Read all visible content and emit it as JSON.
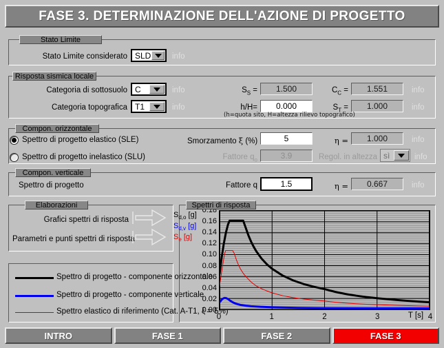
{
  "header": {
    "title": "FASE 3. DETERMINAZIONE DELL'AZIONE DI PROGETTO"
  },
  "colors": {
    "background": "#c0c0c0",
    "panel": "#878787",
    "title_bar": "#828282",
    "active_tab": "#f20000",
    "info_text": "#e0e0e0",
    "curve_horizontal": "#000000",
    "curve_vertical": "#0000ee",
    "curve_elastic": "#e00000"
  },
  "stato_limite": {
    "group_title": "Stato Limite",
    "label": "Stato Limite considerato",
    "value": "SLD",
    "info": "info"
  },
  "risposta_sismica": {
    "group_title": "Risposta sismica locale",
    "sottosuolo_label": "Categoria di sottosuolo",
    "sottosuolo_value": "C",
    "sottosuolo_info": "info",
    "topografica_label": "Categoria topografica",
    "topografica_value": "T1",
    "topografica_info": "info",
    "ss_label": "S",
    "ss_sub": "S",
    "ss_eq": " =",
    "ss_value": "1.500",
    "cc_label": "C",
    "cc_sub": "C",
    "cc_eq": " =",
    "cc_value": "1.551",
    "cc_info": "info",
    "hH_label": "h/H=",
    "hH_value": "0.000",
    "st_label": "S",
    "st_sub": "T",
    "st_eq": " =",
    "st_value": "1.000",
    "st_info": "info",
    "note": "(h=quota sito, H=altezza rilievo topografico)"
  },
  "compon_orizzontale": {
    "group_title": "Compon. orizzontale",
    "radio_sle": "Spettro di progetto elastico (SLE)",
    "radio_slu": "Spettro di progetto inelastico (SLU)",
    "selected": "sle",
    "smorzamento_label": "Smorzamento",
    "smorzamento_symbol": "ξ",
    "smorzamento_unit": "(%)",
    "smorzamento_value": "5",
    "eta_label": "η =",
    "eta_value": "1.000",
    "eta_info": "info",
    "fattore_q0_label": "Fattore q",
    "fattore_q0_sub": "o",
    "fattore_q0_value": "3.9",
    "regol_label": "Regol. in altezza",
    "regol_value": "sì",
    "regol_info": "info"
  },
  "compon_verticale": {
    "group_title": "Compon. verticale",
    "label": "Spettro di progetto",
    "fattore_q_label": "Fattore q",
    "fattore_q_value": "1.5",
    "eta_label": "η =",
    "eta_value": "0.667",
    "eta_info": "info"
  },
  "elaborazioni": {
    "group_title": "Elaborazioni",
    "btn_grafici": "Grafici spettri di risposta",
    "btn_parametri": "Parametri e punti spettri di risposta"
  },
  "legend": {
    "items": [
      {
        "color": "#000000",
        "thickness": 3,
        "text": "Spettro di progetto - componente orizzontale"
      },
      {
        "color": "#0000ee",
        "thickness": 3,
        "text": "Spettro di progetto - componente verticale"
      },
      {
        "color": "#e00000",
        "thickness": 1,
        "text": "Spettro elastico di riferimento (Cat. A-T1, ξ = 5%)"
      }
    ]
  },
  "chart_data": {
    "type": "line",
    "title": "Spettri di risposta",
    "xlabel": "T [s]",
    "ylabel": "",
    "xlim": [
      0,
      4
    ],
    "ylim": [
      0,
      0.18
    ],
    "xticks": [
      0,
      1,
      2,
      3,
      4
    ],
    "xticklabels": [
      "0",
      "1",
      "2",
      "3",
      "4"
    ],
    "yticks": [
      0.0,
      0.02,
      0.04,
      0.06,
      0.08,
      0.1,
      0.12,
      0.14,
      0.16,
      0.18
    ],
    "yticklabels": [
      "0.00",
      "0.02",
      "0.04",
      "0.06",
      "0.08",
      "0.10",
      "0.12",
      "0.14",
      "0.16",
      "0.18"
    ],
    "grid": true,
    "axis_legend": [
      {
        "text": "S",
        "sub": "d,o",
        "unit": "[g]",
        "color": "#000000"
      },
      {
        "text": "S",
        "sub": "d,v",
        "unit": "[g]",
        "color": "#0000ee"
      },
      {
        "text": "S",
        "sub": "e",
        "unit": "[g]",
        "color": "#e00000"
      }
    ],
    "series": [
      {
        "name": "Spettro di progetto - componente orizzontale",
        "color": "#000000",
        "width": 3,
        "points": [
          [
            0.0,
            0.0648
          ],
          [
            0.04,
            0.095
          ],
          [
            0.08,
            0.12
          ],
          [
            0.12,
            0.14
          ],
          [
            0.16,
            0.155
          ],
          [
            0.19,
            0.162
          ],
          [
            0.25,
            0.162
          ],
          [
            0.35,
            0.162
          ],
          [
            0.45,
            0.162
          ],
          [
            0.5,
            0.1485
          ],
          [
            0.55,
            0.135
          ],
          [
            0.6,
            0.1238
          ],
          [
            0.65,
            0.1143
          ],
          [
            0.7,
            0.1061
          ],
          [
            0.8,
            0.0928
          ],
          [
            0.9,
            0.0825
          ],
          [
            1.0,
            0.0743
          ],
          [
            1.2,
            0.0619
          ],
          [
            1.4,
            0.053
          ],
          [
            1.6,
            0.0464
          ],
          [
            1.8,
            0.0413
          ],
          [
            2.0,
            0.0371
          ],
          [
            2.2,
            0.0321
          ],
          [
            2.4,
            0.0282
          ],
          [
            2.6,
            0.0251
          ],
          [
            2.8,
            0.0225
          ],
          [
            3.0,
            0.0204
          ],
          [
            3.2,
            0.0187
          ],
          [
            3.4,
            0.017
          ],
          [
            3.6,
            0.0155
          ],
          [
            3.8,
            0.0142
          ],
          [
            4.0,
            0.013
          ]
        ]
      },
      {
        "name": "Spettro di progetto - componente verticale",
        "color": "#0000ee",
        "width": 3,
        "points": [
          [
            0.0,
            0.013
          ],
          [
            0.03,
            0.0165
          ],
          [
            0.05,
            0.019
          ],
          [
            0.08,
            0.0205
          ],
          [
            0.1,
            0.021
          ],
          [
            0.13,
            0.0205
          ],
          [
            0.16,
            0.019
          ],
          [
            0.2,
            0.016
          ],
          [
            0.25,
            0.013
          ],
          [
            0.3,
            0.0108
          ],
          [
            0.4,
            0.0082
          ],
          [
            0.5,
            0.0068
          ],
          [
            0.6,
            0.0058
          ],
          [
            0.8,
            0.0048
          ],
          [
            1.0,
            0.004
          ],
          [
            1.2,
            0.0034
          ],
          [
            1.5,
            0.0028
          ],
          [
            2.0,
            0.0024
          ],
          [
            2.5,
            0.0022
          ],
          [
            3.0,
            0.0021
          ],
          [
            3.5,
            0.002
          ],
          [
            4.0,
            0.002
          ]
        ]
      },
      {
        "name": "Spettro elastico di riferimento (Cat. A-T1, ξ = 5%)",
        "color": "#e00000",
        "width": 1,
        "points": [
          [
            0.0,
            0.0432
          ],
          [
            0.02,
            0.056
          ],
          [
            0.04,
            0.069
          ],
          [
            0.06,
            0.081
          ],
          [
            0.08,
            0.093
          ],
          [
            0.1,
            0.103
          ],
          [
            0.115,
            0.1075
          ],
          [
            0.15,
            0.1075
          ],
          [
            0.2,
            0.1075
          ],
          [
            0.25,
            0.1075
          ],
          [
            0.28,
            0.102
          ],
          [
            0.32,
            0.0905
          ],
          [
            0.36,
            0.081
          ],
          [
            0.4,
            0.0735
          ],
          [
            0.45,
            0.066
          ],
          [
            0.5,
            0.06
          ],
          [
            0.6,
            0.05
          ],
          [
            0.7,
            0.0428
          ],
          [
            0.8,
            0.0378
          ],
          [
            0.9,
            0.0338
          ],
          [
            1.0,
            0.0302
          ],
          [
            1.2,
            0.0251
          ],
          [
            1.4,
            0.0216
          ],
          [
            1.6,
            0.019
          ],
          [
            1.8,
            0.017
          ],
          [
            2.0,
            0.0152
          ],
          [
            2.2,
            0.0132
          ],
          [
            2.4,
            0.0116
          ],
          [
            2.6,
            0.0104
          ],
          [
            2.8,
            0.0095
          ],
          [
            3.0,
            0.0087
          ],
          [
            3.2,
            0.008
          ],
          [
            3.4,
            0.0074
          ],
          [
            3.6,
            0.0069
          ],
          [
            3.8,
            0.0064
          ],
          [
            4.0,
            0.006
          ]
        ]
      }
    ]
  },
  "nav": {
    "tabs": [
      {
        "label": "INTRO",
        "active": false
      },
      {
        "label": "FASE 1",
        "active": false
      },
      {
        "label": "FASE 2",
        "active": false
      },
      {
        "label": "FASE 3",
        "active": true
      }
    ]
  }
}
